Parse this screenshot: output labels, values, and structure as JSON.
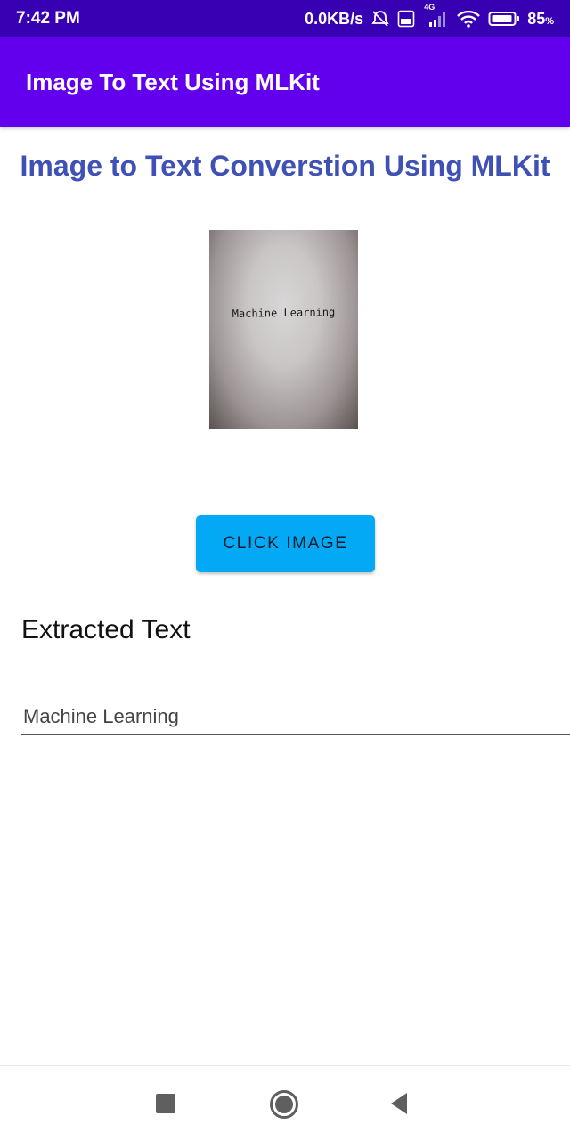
{
  "status_bar": {
    "time": "7:42 PM",
    "net_speed": "0.0KB/s",
    "network_type": "4G",
    "battery_percent": "85",
    "battery_unit": "%",
    "icons": [
      "alarm-off-icon",
      "volte-icon",
      "signal-icon",
      "wifi-icon",
      "battery-icon"
    ]
  },
  "app_bar": {
    "title": "Image To Text Using MLKit"
  },
  "main": {
    "heading": "Image to Text Converstion Using MLKit",
    "image_preview_text": "Machine Learning",
    "click_button_label": "CLICK IMAGE",
    "extracted_label": "Extracted Text",
    "extracted_value": "Machine Learning"
  },
  "nav_bar": {
    "icons": [
      "recents-icon",
      "home-icon",
      "back-icon"
    ]
  },
  "colors": {
    "status_bar": "#3700b3",
    "app_bar": "#6200ee",
    "heading": "#3f51b5",
    "button": "#03a9f4"
  }
}
